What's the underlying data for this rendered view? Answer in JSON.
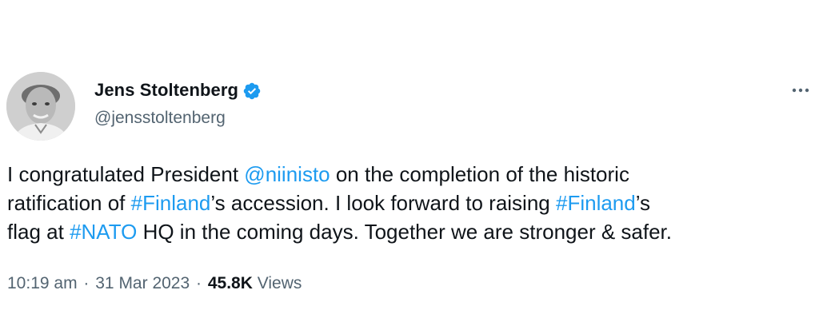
{
  "author": {
    "display_name": "Jens Stoltenberg",
    "handle": "@jensstoltenberg",
    "verified_icon": "verified-badge-icon",
    "verified_color": "#1d9bf0"
  },
  "more_icon": "more-options-icon",
  "tweet": {
    "segments_line1": [
      {
        "text": "I congratulated President ",
        "link": false
      },
      {
        "text": "@niinisto",
        "link": true
      },
      {
        "text": " on the completion of the historic",
        "link": false
      }
    ],
    "segments_line2": [
      {
        "text": "ratification of ",
        "link": false
      },
      {
        "text": "#Finland",
        "link": true
      },
      {
        "text": "’s accession. I look forward to raising ",
        "link": false
      },
      {
        "text": "#Finland",
        "link": true
      },
      {
        "text": "’s",
        "link": false
      }
    ],
    "segments_line3": [
      {
        "text": "flag at ",
        "link": false
      },
      {
        "text": "#NATO",
        "link": true
      },
      {
        "text": " HQ in the coming days. Together we are stronger & safer.",
        "link": false
      }
    ]
  },
  "meta": {
    "time": "10:19 am",
    "separator": "·",
    "date": "31 Mar 2023",
    "views_count": "45.8K",
    "views_label": "Views"
  },
  "colors": {
    "link": "#1d9bf0",
    "text": "#0f1419",
    "secondary": "#536471"
  }
}
